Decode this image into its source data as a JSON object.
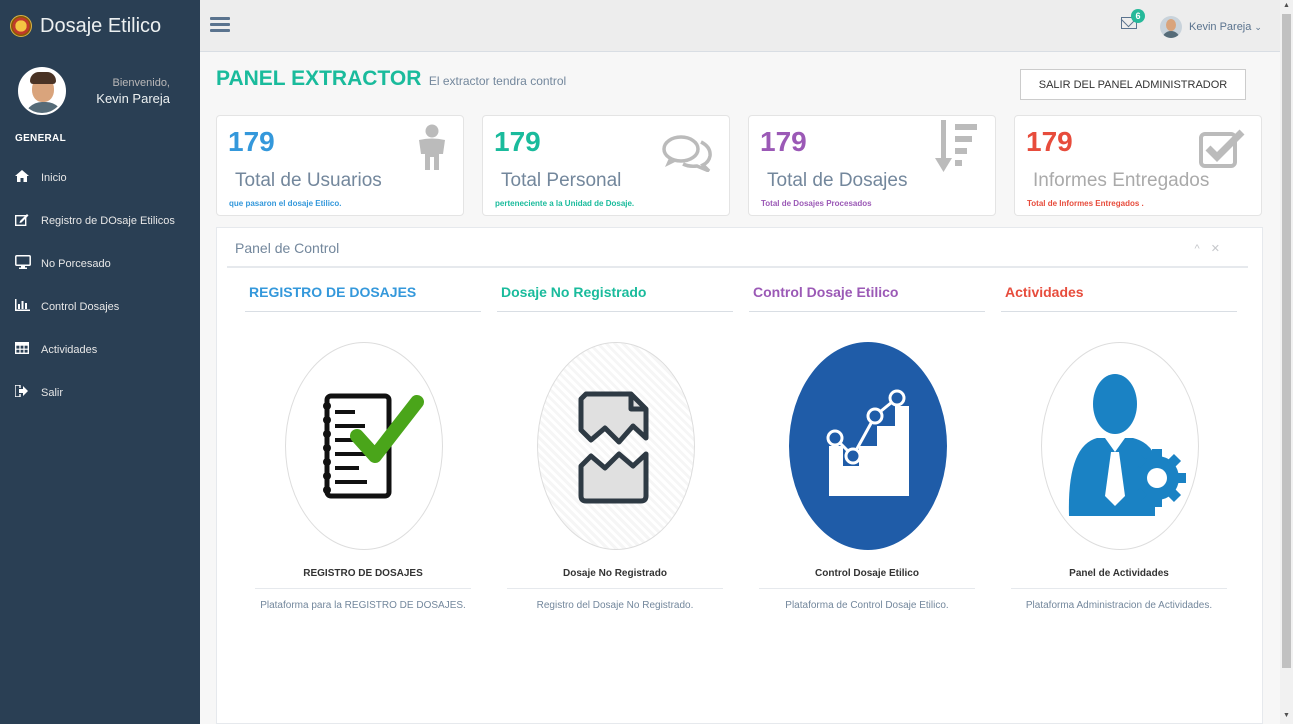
{
  "brand": {
    "title": "Dosaje Etilico"
  },
  "profile": {
    "welcome": "Bienvenido,",
    "name": "Kevin Pareja"
  },
  "sidebar": {
    "section": "GENERAL",
    "items": [
      {
        "label": "Inicio",
        "icon": "home-icon"
      },
      {
        "label": "Registro de DOsaje Etilicos",
        "icon": "edit-icon"
      },
      {
        "label": "No Porcesado",
        "icon": "desktop-icon"
      },
      {
        "label": "Control Dosajes",
        "icon": "bar-chart-icon"
      },
      {
        "label": "Actividades",
        "icon": "table-icon"
      },
      {
        "label": "Salir",
        "icon": "sign-out-icon"
      }
    ]
  },
  "topbar": {
    "mail_count": "6",
    "user": "Kevin Pareja"
  },
  "page": {
    "title": "PANEL EXTRACTOR",
    "subtitle": "El extractor tendra control",
    "exit_button": "SALIR DEL PANEL ADMINISTRADOR"
  },
  "tiles": [
    {
      "number": "179",
      "label": "Total de Usuarios",
      "sub": "que pasaron el dosaje Etilico.",
      "color": "#3498db",
      "icon": "user-icon"
    },
    {
      "number": "179",
      "label": "Total Personal",
      "sub": "perteneciente a la Unidad de Dosaje.",
      "color": "#1abb9c",
      "icon": "comments-icon"
    },
    {
      "number": "179",
      "label": "Total de Dosajes",
      "sub": "Total de Dosajes Procesados",
      "color": "#9b59b6",
      "icon": "sort-amount-icon"
    },
    {
      "number": "179",
      "label": "Informes Entregados",
      "sub": "Total de Informes Entregados .",
      "color": "#e74c3c",
      "icon": "check-square-icon"
    }
  ],
  "panel": {
    "title": "Panel de Control",
    "columns": [
      {
        "heading": "REGISTRO DE DOSAJES",
        "color": "#3498db",
        "caption": "REGISTRO DE DOSAJES",
        "desc": "Plataforma para la REGISTRO DE DOSAJES."
      },
      {
        "heading": "Dosaje No Registrado",
        "color": "#1abb9c",
        "caption": "Dosaje No Registrado",
        "desc": "Registro del Dosaje No Registrado."
      },
      {
        "heading": "Control Dosaje Etilico",
        "color": "#9b59b6",
        "caption": "Control Dosaje Etilico",
        "desc": "Plataforma de Control Dosaje Etilico."
      },
      {
        "heading": "Actividades",
        "color": "#e74c3c",
        "caption": "Panel de Actividades",
        "desc": "Plataforma Administracion de Actividades."
      }
    ]
  }
}
